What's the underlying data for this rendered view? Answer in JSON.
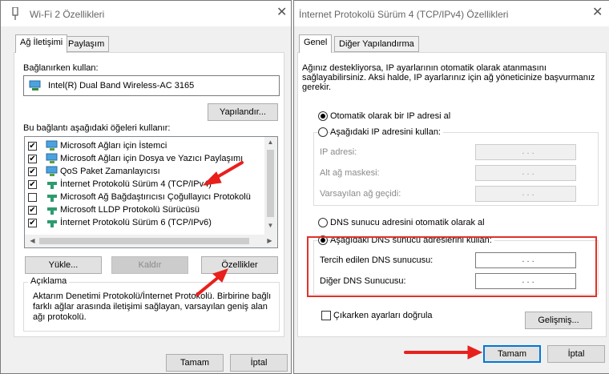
{
  "left_window": {
    "title": "Wi-Fi 2 Özellikleri",
    "tabs": [
      "Ağ İletişimi",
      "Paylaşım"
    ],
    "connect_using_label": "Bağlanırken kullan:",
    "adapter_name": "Intel(R) Dual Band Wireless-AC 3165",
    "configure_button": "Yapılandır...",
    "items_label": "Bu bağlantı aşağıdaki öğeleri kullanır:",
    "items": [
      {
        "label": "Microsoft Ağları için İstemci",
        "checked": true
      },
      {
        "label": "Microsoft Ağları için Dosya ve Yazıcı Paylaşımı",
        "checked": true
      },
      {
        "label": "QoS Paket Zamanlayıcısı",
        "checked": true
      },
      {
        "label": "İnternet Protokolü Sürüm 4 (TCP/IPv4)",
        "checked": true
      },
      {
        "label": "Microsoft Ağ Bağdaştırıcısı Çoğullayıcı Protokolü",
        "checked": false
      },
      {
        "label": "Microsoft LLDP Protokolü Sürücüsü",
        "checked": true
      },
      {
        "label": "İnternet Protokolü Sürüm 6 (TCP/IPv6)",
        "checked": true
      }
    ],
    "install_button": "Yükle...",
    "uninstall_button": "Kaldır",
    "properties_button": "Özellikler",
    "description_label": "Açıklama",
    "description_text": "Aktarım Denetimi Protokolü/İnternet Protokolü. Birbirine bağlı farklı ağlar arasında iletişimi sağlayan, varsayılan geniş alan ağı protokolü.",
    "ok_button": "Tamam",
    "cancel_button": "İptal"
  },
  "right_window": {
    "title": "İnternet Protokolü Sürüm 4 (TCP/IPv4) Özellikleri",
    "tabs": [
      "Genel",
      "Diğer Yapılandırma"
    ],
    "intro_text": "Ağınız destekliyorsa, IP ayarlarının otomatik olarak atanmasını sağlayabilirsiniz. Aksi halde, IP ayarlarınız için ağ yöneticinize başvurmanız gerekir.",
    "ip_auto_radio": "Otomatik olarak bir IP adresi al",
    "ip_manual_radio": "Aşağıdaki IP adresini kullan:",
    "ip_address_label": "IP adresi:",
    "subnet_label": "Alt ağ maskesi:",
    "gateway_label": "Varsayılan ağ geçidi:",
    "ip_dots": ".   .   .",
    "dns_auto_radio": "DNS sunucu adresini otomatik olarak al",
    "dns_manual_radio": "Aşağıdaki DNS sunucu adreslerini kullan:",
    "preferred_dns_label": "Tercih edilen DNS sunucusu:",
    "alternate_dns_label": "Diğer DNS Sunucusu:",
    "validate_checkbox": "Çıkarken ayarları doğrula",
    "advanced_button": "Gelişmiş...",
    "ok_button": "Tamam",
    "cancel_button": "İptal"
  },
  "colors": {
    "highlight_box": "#e0322a",
    "annotation_arrow": "#e8201c",
    "default_button_border": "#0078d7"
  }
}
